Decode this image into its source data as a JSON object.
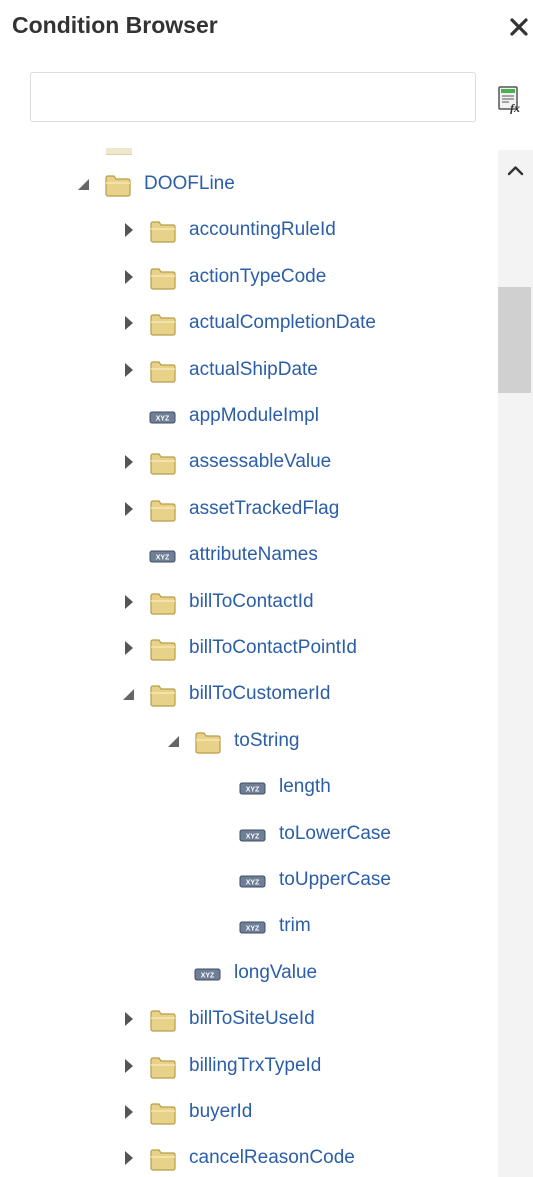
{
  "panel": {
    "title": "Condition Browser",
    "close_icon": "close-icon",
    "search": {
      "value": "",
      "placeholder": ""
    },
    "expression_icon": "expression-builder-icon"
  },
  "colors": {
    "label": "#2a5ea8",
    "title": "#333333",
    "folder": "#e8d28a"
  },
  "tree": [
    {
      "label": "DOOFLine",
      "depth": 0,
      "type": "folder",
      "state": "expanded"
    },
    {
      "label": "accountingRuleId",
      "depth": 1,
      "type": "folder",
      "state": "collapsed"
    },
    {
      "label": "actionTypeCode",
      "depth": 1,
      "type": "folder",
      "state": "collapsed"
    },
    {
      "label": "actualCompletionDate",
      "depth": 1,
      "type": "folder",
      "state": "collapsed"
    },
    {
      "label": "actualShipDate",
      "depth": 1,
      "type": "folder",
      "state": "collapsed"
    },
    {
      "label": "appModuleImpl",
      "depth": 1,
      "type": "leaf",
      "state": "none"
    },
    {
      "label": "assessableValue",
      "depth": 1,
      "type": "folder",
      "state": "collapsed"
    },
    {
      "label": "assetTrackedFlag",
      "depth": 1,
      "type": "folder",
      "state": "collapsed"
    },
    {
      "label": "attributeNames",
      "depth": 1,
      "type": "leaf",
      "state": "none"
    },
    {
      "label": "billToContactId",
      "depth": 1,
      "type": "folder",
      "state": "collapsed"
    },
    {
      "label": "billToContactPointId",
      "depth": 1,
      "type": "folder",
      "state": "collapsed"
    },
    {
      "label": "billToCustomerId",
      "depth": 1,
      "type": "folder",
      "state": "expanded"
    },
    {
      "label": "toString",
      "depth": 2,
      "type": "folder",
      "state": "expanded"
    },
    {
      "label": "length",
      "depth": 3,
      "type": "leaf",
      "state": "none"
    },
    {
      "label": "toLowerCase",
      "depth": 3,
      "type": "leaf",
      "state": "none"
    },
    {
      "label": "toUpperCase",
      "depth": 3,
      "type": "leaf",
      "state": "none"
    },
    {
      "label": "trim",
      "depth": 3,
      "type": "leaf",
      "state": "none"
    },
    {
      "label": "longValue",
      "depth": 2,
      "type": "leaf",
      "state": "none"
    },
    {
      "label": "billToSiteUseId",
      "depth": 1,
      "type": "folder",
      "state": "collapsed"
    },
    {
      "label": "billingTrxTypeId",
      "depth": 1,
      "type": "folder",
      "state": "collapsed"
    },
    {
      "label": "buyerId",
      "depth": 1,
      "type": "folder",
      "state": "collapsed"
    },
    {
      "label": "cancelReasonCode",
      "depth": 1,
      "type": "folder",
      "state": "collapsed"
    }
  ],
  "scrollbar": {
    "up_icon": "chevron-up-icon",
    "position": 0.13
  }
}
